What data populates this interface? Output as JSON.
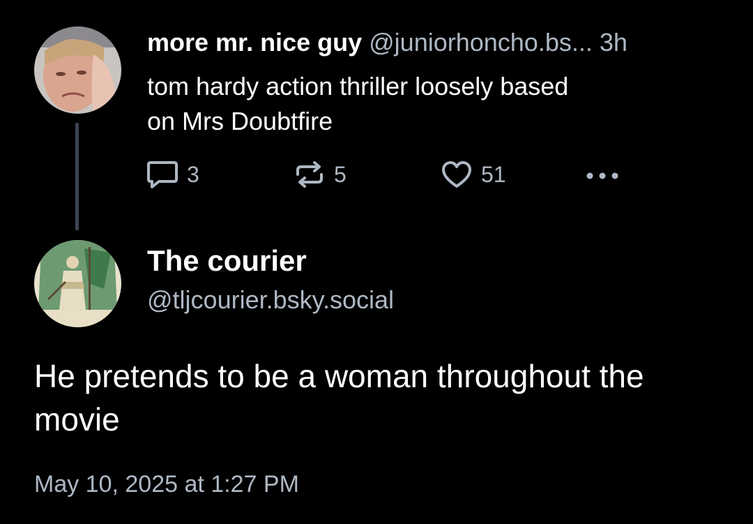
{
  "parent_post": {
    "display_name": "more mr. nice guy",
    "handle": "@juniorhoncho.bs...",
    "age": "3h",
    "text_line1": "tom hardy action thriller loosely based",
    "text_line2": "on Mrs Doubtfire",
    "actions": {
      "reply_icon": "speech-bubble-icon",
      "reply_count": "3",
      "repost_icon": "repost-arrows-icon",
      "repost_count": "5",
      "like_icon": "heart-icon",
      "like_count": "51",
      "more_icon": "ellipsis-icon"
    }
  },
  "reply_post": {
    "display_name": "The courier",
    "handle": "@tljcourier.bsky.social",
    "text": "He pretends to be a woman throughout the movie",
    "timestamp": "May 10, 2025 at 1:27 PM"
  },
  "colors": {
    "background": "#000000",
    "primary_text": "#ffffff",
    "secondary_text": "#aeb8c4",
    "thread_line": "#3c4552"
  }
}
